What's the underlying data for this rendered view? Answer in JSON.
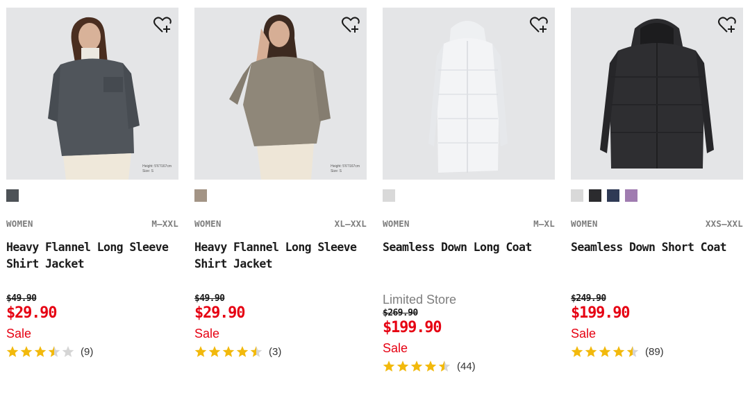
{
  "colors": {
    "sale_red": "#e60012",
    "star_gold": "#f2b90c",
    "star_empty": "#d5d5d5"
  },
  "favorite_icon": "heart-plus-icon",
  "products": [
    {
      "name": "Heavy Flannel Long Sleeve Shirt Jacket",
      "gender": "WOMEN",
      "sizes": "M–XXL",
      "photo_note": [
        "Height: 5'6\"/167cm",
        "Size: S"
      ],
      "swatches": [
        "#4d5257"
      ],
      "limited": "",
      "original_price": "$49.90",
      "price": "$29.90",
      "sale_label": "Sale",
      "rating": 3.5,
      "review_count": "(9)"
    },
    {
      "name": "Heavy Flannel Long Sleeve Shirt Jacket",
      "gender": "WOMEN",
      "sizes": "XL–XXL",
      "photo_note": [
        "Height: 5'6\"/167cm",
        "Size: S"
      ],
      "swatches": [
        "#a39485"
      ],
      "limited": "",
      "original_price": "$49.90",
      "price": "$29.90",
      "sale_label": "Sale",
      "rating": 4.5,
      "review_count": "(3)"
    },
    {
      "name": "Seamless Down Long Coat",
      "gender": "WOMEN",
      "sizes": "M–XL",
      "photo_note": [],
      "swatches": [
        "#d9d9d9"
      ],
      "limited": "Limited Store",
      "original_price": "$269.90",
      "price": "$199.90",
      "sale_label": "Sale",
      "rating": 4.5,
      "review_count": "(44)"
    },
    {
      "name": "Seamless Down Short Coat",
      "gender": "WOMEN",
      "sizes": "XXS–XXL",
      "photo_note": [],
      "swatches": [
        "#d9d9d9",
        "#2b2b2e",
        "#2f3a55",
        "#a07cb0"
      ],
      "limited": "",
      "original_price": "$249.90",
      "price": "$199.90",
      "sale_label": "Sale",
      "rating": 4.5,
      "review_count": "(89)"
    }
  ]
}
